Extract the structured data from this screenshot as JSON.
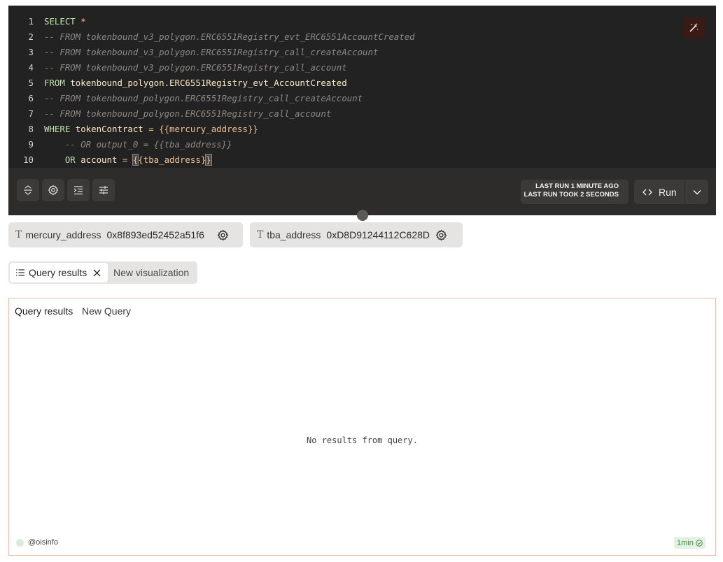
{
  "editor": {
    "lines": [
      {
        "num": "1",
        "parts": [
          {
            "t": "SELECT ",
            "c": "kw"
          },
          {
            "t": "*",
            "c": "op"
          }
        ]
      },
      {
        "num": "2",
        "parts": [
          {
            "t": "-- FROM tokenbound_v3_polygon.ERC6551Registry_evt_ERC6551AccountCreated",
            "c": "cm"
          }
        ]
      },
      {
        "num": "3",
        "parts": [
          {
            "t": "-- FROM tokenbound_v3_polygon.ERC6551Registry_call_createAccount",
            "c": "cm"
          }
        ]
      },
      {
        "num": "4",
        "parts": [
          {
            "t": "-- FROM tokenbound_v3_polygon.ERC6551Registry_call_account",
            "c": "cm"
          }
        ]
      },
      {
        "num": "5",
        "parts": [
          {
            "t": "FROM ",
            "c": "kw"
          },
          {
            "t": "tokenbound_polygon.ERC6551Registry_evt_AccountCreated",
            "c": "id"
          }
        ]
      },
      {
        "num": "6",
        "parts": [
          {
            "t": "-- FROM tokenbound_polygon.ERC6551Registry_call_createAccount",
            "c": "cm"
          }
        ]
      },
      {
        "num": "7",
        "parts": [
          {
            "t": "-- FROM tokenbound_polygon.ERC6551Registry_call_account",
            "c": "cm"
          }
        ]
      },
      {
        "num": "8",
        "parts": [
          {
            "t": "WHERE ",
            "c": "kw"
          },
          {
            "t": "tokenContract ",
            "c": "id"
          },
          {
            "t": "= ",
            "c": "op"
          },
          {
            "t": "{{mercury_address}}",
            "c": "op"
          }
        ]
      },
      {
        "num": "9",
        "parts": [
          {
            "t": "    -- OR output_0 = {{tba_address}}",
            "c": "cm"
          }
        ]
      },
      {
        "num": "10",
        "parts": [
          {
            "t": "    OR ",
            "c": "kw"
          },
          {
            "t": "account ",
            "c": "id"
          },
          {
            "t": "= ",
            "c": "op"
          },
          {
            "t": "{",
            "c": "op hl"
          },
          {
            "t": "{tba_address}",
            "c": "op"
          },
          {
            "t": "}",
            "c": "op hl"
          }
        ]
      }
    ]
  },
  "toolbar": {
    "last_run_line1": "LAST RUN 1 MINUTE AGO",
    "last_run_line2": "LAST RUN TOOK 2 SECONDS",
    "run_label": "Run"
  },
  "params": [
    {
      "name": "mercury_address",
      "value": "0x8f893ed52452a51f6"
    },
    {
      "name": "tba_address",
      "value": "0xD8D91244112C628D"
    }
  ],
  "tabs": {
    "active_label": "Query results",
    "new_label": "New visualization"
  },
  "results": {
    "title": "Query results",
    "subtitle": "New Query",
    "empty_message": "No results from query.",
    "owner": "@oisinfo",
    "age": "1min"
  },
  "colors": {
    "editor_bg": "#232222",
    "toolbar_bg": "#2d2c2b",
    "panel_border": "#f1b9aa",
    "badge_green": "#3a8f3a"
  }
}
